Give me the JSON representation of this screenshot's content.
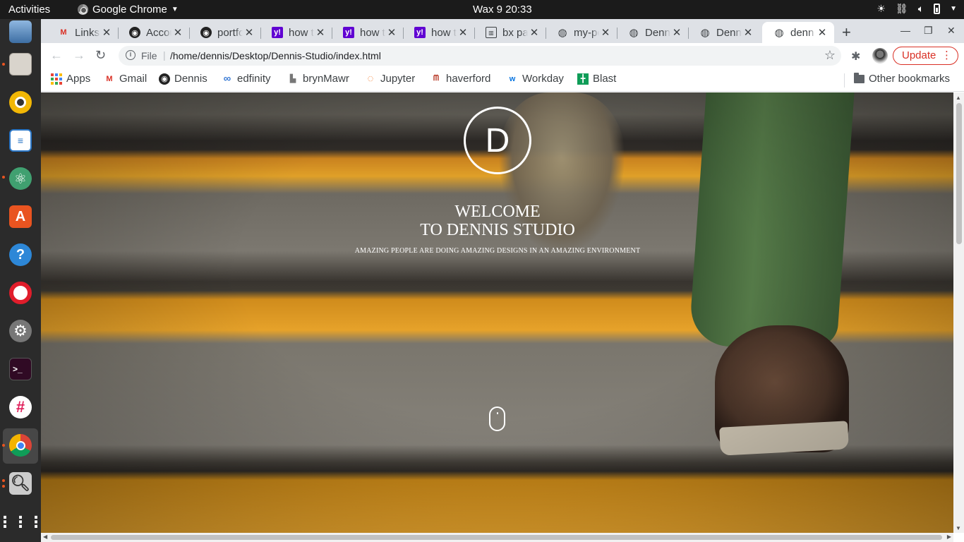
{
  "topbar": {
    "activities": "Activities",
    "app_name": "Google Chrome",
    "clock": "Wax 9  20:33"
  },
  "dock": {
    "items": [
      "software-icon",
      "files-icon",
      "rhythmbox-icon",
      "writer-icon",
      "atom-icon",
      "app-center-icon",
      "help-icon",
      "opera-icon",
      "settings-icon",
      "terminal-icon",
      "slack-icon",
      "chrome-icon",
      "search-tool-icon",
      "show-apps-icon"
    ]
  },
  "tabs": [
    {
      "title": "Links",
      "favicon": "gmail"
    },
    {
      "title": "Accou",
      "favicon": "github"
    },
    {
      "title": "portfo",
      "favicon": "github"
    },
    {
      "title": "how t",
      "favicon": "yahoo"
    },
    {
      "title": "how t",
      "favicon": "yahoo"
    },
    {
      "title": "how t",
      "favicon": "yahoo"
    },
    {
      "title": "bx pa",
      "favicon": "doc"
    },
    {
      "title": "my-po",
      "favicon": "globe"
    },
    {
      "title": "Denn",
      "favicon": "globe"
    },
    {
      "title": "Denn",
      "favicon": "globe"
    },
    {
      "title": "denn",
      "favicon": "globe"
    }
  ],
  "toolbar": {
    "file_label": "File",
    "url": "/home/dennis/Desktop/Dennis-Studio/index.html",
    "update_label": "Update"
  },
  "bookmarks": {
    "items": [
      "Apps",
      "Gmail",
      "Dennis",
      "edfinity",
      "brynMawr",
      "Jupyter",
      "haverford",
      "Workday",
      "Blast"
    ],
    "other": "Other bookmarks"
  },
  "page": {
    "logo_letter": "D",
    "title_line1": "WELCOME",
    "title_line2": "TO DENNIS STUDIO",
    "subtitle": "AMAZING PEOPLE ARE DOING AMAZING DESIGNS IN AN AMAZING ENVIRONMENT"
  },
  "colors": {
    "accent_update": "#d93025",
    "stair_yellow": "#e0a028",
    "tab_strip": "#dee1e6"
  }
}
